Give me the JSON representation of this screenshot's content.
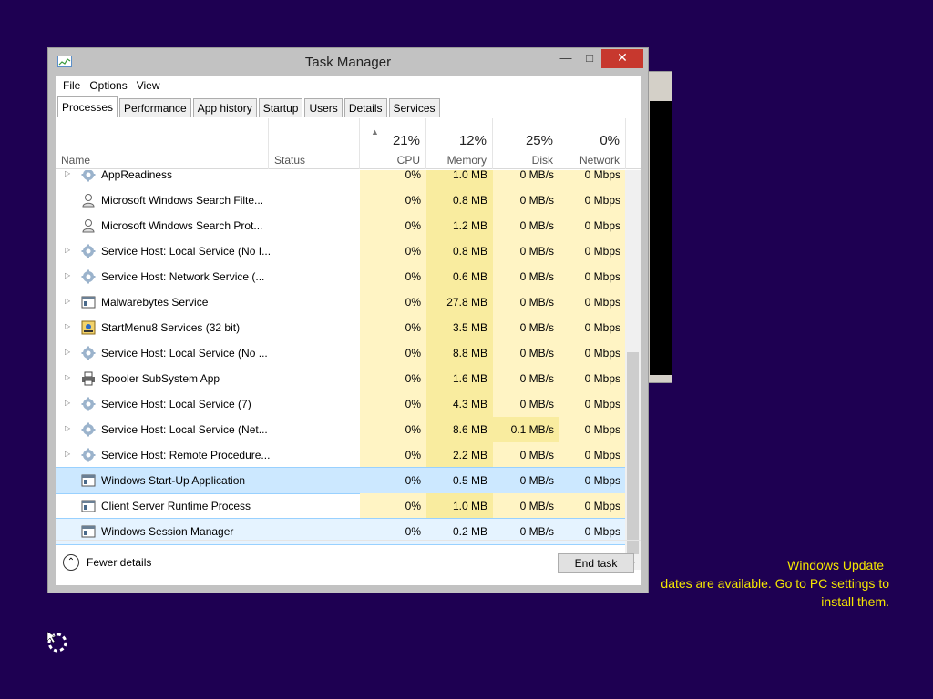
{
  "window": {
    "title": "Task Manager",
    "min": "—",
    "max": "□",
    "close": "✕"
  },
  "menu": [
    "File",
    "Options",
    "View"
  ],
  "tabs": [
    "Processes",
    "Performance",
    "App history",
    "Startup",
    "Users",
    "Details",
    "Services"
  ],
  "header": {
    "name": "Name",
    "status": "Status",
    "cpu_pct": "21%",
    "cpu": "CPU",
    "mem_pct": "12%",
    "mem": "Memory",
    "disk_pct": "25%",
    "disk": "Disk",
    "net_pct": "0%",
    "net": "Network"
  },
  "rows": [
    {
      "name": "AppReadiness",
      "cpu": "0%",
      "mem": "1.0 MB",
      "disk": "0 MB/s",
      "net": "0 Mbps",
      "icon": "gear-icon",
      "expand": true
    },
    {
      "name": "Microsoft Windows Search Filte...",
      "cpu": "0%",
      "mem": "0.8 MB",
      "disk": "0 MB/s",
      "net": "0 Mbps",
      "icon": "search-user-icon",
      "expand": false
    },
    {
      "name": "Microsoft Windows Search Prot...",
      "cpu": "0%",
      "mem": "1.2 MB",
      "disk": "0 MB/s",
      "net": "0 Mbps",
      "icon": "search-user-icon",
      "expand": false
    },
    {
      "name": "Service Host: Local Service (No I...",
      "cpu": "0%",
      "mem": "0.8 MB",
      "disk": "0 MB/s",
      "net": "0 Mbps",
      "icon": "gear-icon",
      "expand": true
    },
    {
      "name": "Service Host: Network Service (...",
      "cpu": "0%",
      "mem": "0.6 MB",
      "disk": "0 MB/s",
      "net": "0 Mbps",
      "icon": "gear-icon",
      "expand": true
    },
    {
      "name": "Malwarebytes Service",
      "cpu": "0%",
      "mem": "27.8 MB",
      "disk": "0 MB/s",
      "net": "0 Mbps",
      "icon": "window-icon",
      "expand": true
    },
    {
      "name": "StartMenu8 Services (32 bit)",
      "cpu": "0%",
      "mem": "3.5 MB",
      "disk": "0 MB/s",
      "net": "0 Mbps",
      "icon": "startmenu-icon",
      "expand": true
    },
    {
      "name": "Service Host: Local Service (No ...",
      "cpu": "0%",
      "mem": "8.8 MB",
      "disk": "0 MB/s",
      "net": "0 Mbps",
      "icon": "gear-icon",
      "expand": true
    },
    {
      "name": "Spooler SubSystem App",
      "cpu": "0%",
      "mem": "1.6 MB",
      "disk": "0 MB/s",
      "net": "0 Mbps",
      "icon": "printer-icon",
      "expand": true
    },
    {
      "name": "Service Host: Local Service (7)",
      "cpu": "0%",
      "mem": "4.3 MB",
      "disk": "0 MB/s",
      "net": "0 Mbps",
      "icon": "gear-icon",
      "expand": true
    },
    {
      "name": "Service Host: Local Service (Net...",
      "cpu": "0%",
      "mem": "8.6 MB",
      "disk": "0.1 MB/s",
      "net": "0 Mbps",
      "icon": "gear-icon",
      "expand": true
    },
    {
      "name": "Service Host: Remote Procedure...",
      "cpu": "0%",
      "mem": "2.2 MB",
      "disk": "0 MB/s",
      "net": "0 Mbps",
      "icon": "gear-icon",
      "expand": true
    },
    {
      "name": "Windows Start-Up Application",
      "cpu": "0%",
      "mem": "0.5 MB",
      "disk": "0 MB/s",
      "net": "0 Mbps",
      "icon": "window-icon",
      "expand": false
    },
    {
      "name": "Client Server Runtime Process",
      "cpu": "0%",
      "mem": "1.0 MB",
      "disk": "0 MB/s",
      "net": "0 Mbps",
      "icon": "window-icon",
      "expand": false
    },
    {
      "name": "Windows Session Manager",
      "cpu": "0%",
      "mem": "0.2 MB",
      "disk": "0 MB/s",
      "net": "0 Mbps",
      "icon": "window-icon",
      "expand": false
    }
  ],
  "footer": {
    "fewer": "Fewer details",
    "end_task": "End task"
  },
  "notification": {
    "line1": "Windows Update",
    "line2": "dates are available. Go to PC settings to",
    "line3": "install them."
  }
}
